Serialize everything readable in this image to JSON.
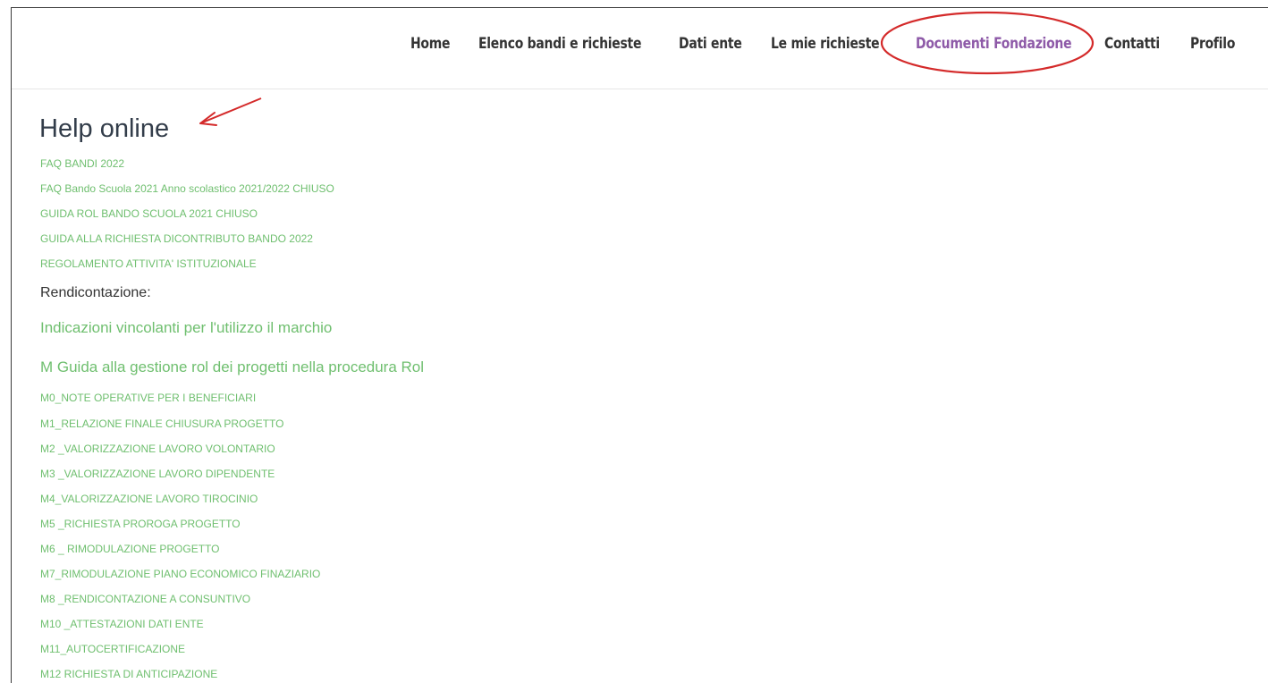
{
  "nav": {
    "items": [
      {
        "label": "Home",
        "active": false
      },
      {
        "label": "Elenco bandi e richieste",
        "active": false
      },
      {
        "label": "Dati ente",
        "active": false
      },
      {
        "label": "Le mie richieste",
        "active": false
      },
      {
        "label": "Documenti Fondazione",
        "active": true
      },
      {
        "label": "Contatti",
        "active": false
      },
      {
        "label": "Profilo",
        "active": false
      }
    ]
  },
  "page": {
    "title": "Help online",
    "links_top": [
      "FAQ BANDI 2022",
      "FAQ Bando Scuola 2021 Anno scolastico 2021/2022 CHIUSO",
      "GUIDA ROL BANDO SCUOLA 2021 CHIUSO",
      "GUIDA ALLA RICHIESTA DICONTRIBUTO BANDO 2022",
      "REGOLAMENTO ATTIVITA' ISTITUZIONALE"
    ],
    "section_label": "Rendicontazione:",
    "large_links": [
      "Indicazioni vincolanti per l'utilizzo il marchio",
      "M Guida alla gestione rol dei progetti nella procedura Rol"
    ],
    "links_modules": [
      "M0_NOTE OPERATIVE PER I BENEFICIARI",
      "M1_RELAZIONE FINALE CHIUSURA PROGETTO",
      "M2 _VALORIZZAZIONE LAVORO VOLONTARIO",
      "M3 _VALORIZZAZIONE LAVORO DIPENDENTE",
      "M4_VALORIZZAZIONE LAVORO TIROCINIO",
      "M5 _RICHIESTA PROROGA PROGETTO",
      "M6 _ RIMODULAZIONE PROGETTO",
      "M7_RIMODULAZIONE PIANO ECONOMICO FINAZIARIO",
      "M8 _RENDICONTAZIONE A CONSUNTIVO",
      "M10 _ATTESTAZIONI DATI ENTE",
      "M11_AUTOCERTIFICAZIONE",
      "M12 RICHIESTA DI ANTICIPAZIONE"
    ]
  },
  "colors": {
    "link_green": "#6fbf6f",
    "nav_active": "#8e5aa8",
    "nav_text": "#333333",
    "annotation_red": "#d42a2a",
    "title_text": "#333d4a"
  }
}
